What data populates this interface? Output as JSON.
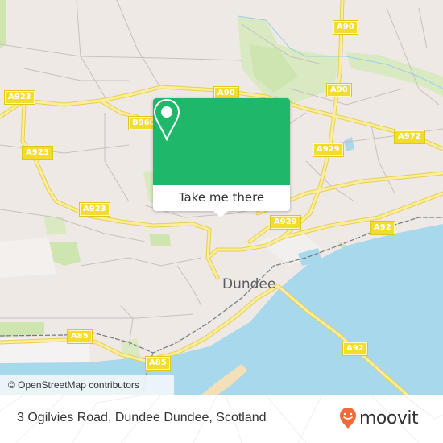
{
  "map": {
    "city_label": "Dundee",
    "road_labels": [
      {
        "text": "A90",
        "id": "a90-north"
      },
      {
        "text": "A90",
        "id": "a90-mid"
      },
      {
        "text": "A90",
        "id": "a90-west"
      },
      {
        "text": "A923",
        "id": "a923-west"
      },
      {
        "text": "A923",
        "id": "a923-mid"
      },
      {
        "text": "A923",
        "id": "a923-south"
      },
      {
        "text": "B960",
        "id": "b960"
      },
      {
        "text": "A929",
        "id": "a929-north"
      },
      {
        "text": "A929",
        "id": "a929-south"
      },
      {
        "text": "A972",
        "id": "a972"
      },
      {
        "text": "A92",
        "id": "a92-east"
      },
      {
        "text": "A92",
        "id": "a92-bridge"
      },
      {
        "text": "A85",
        "id": "a85-west"
      },
      {
        "text": "A85",
        "id": "a85-south"
      }
    ],
    "attribution": "© OpenStreetMap contributors",
    "colors": {
      "land": "#efe9e6",
      "water": "#a8d8ec",
      "park": "#cfe5b0",
      "road": "#f5e07a",
      "sand": "#f3dfb8"
    }
  },
  "popup": {
    "icon": "map-pin-icon",
    "button_label": "Take me there",
    "color": "#1fb86a"
  },
  "footer": {
    "address": "3 Ogilvies Road, Dundee Dundee, Scotland",
    "brand": "moovit",
    "brand_color": "#f26a3a"
  }
}
